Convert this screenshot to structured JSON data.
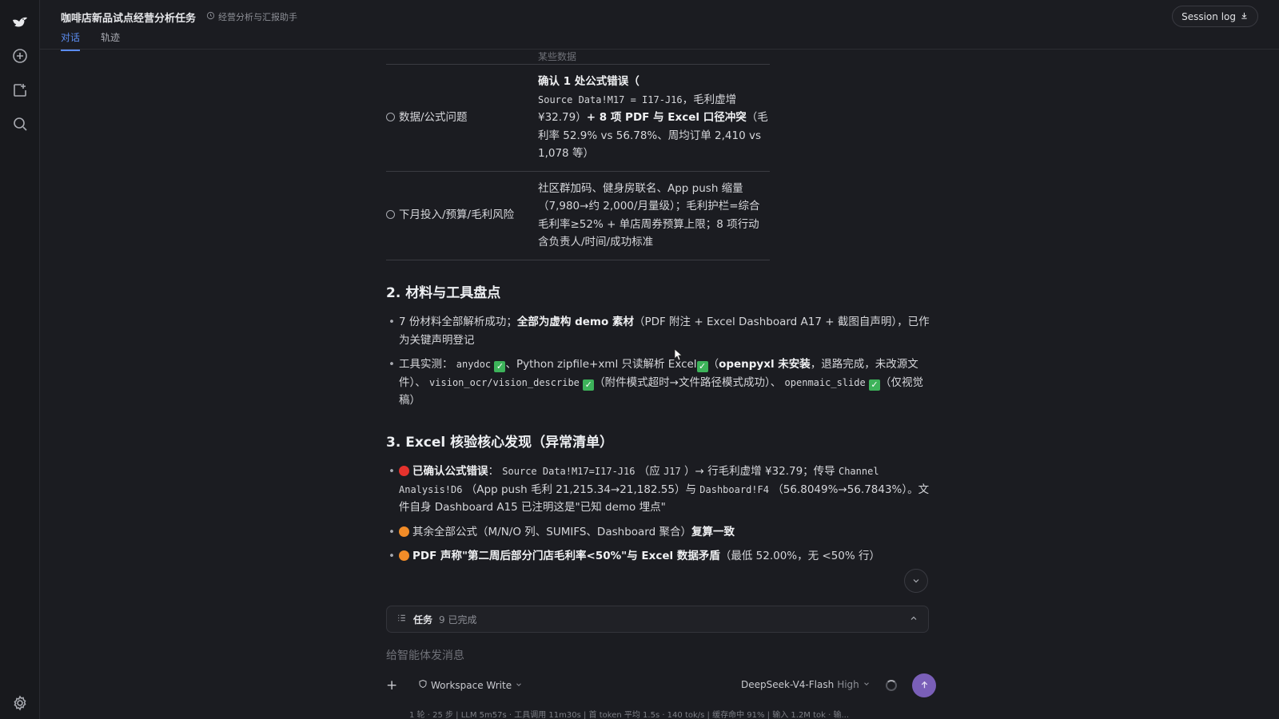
{
  "header": {
    "task_title": "咖啡店新品试点经营分析任务",
    "assistant_name": "经营分析与汇报助手",
    "tabs": [
      {
        "label": "对话",
        "active": true
      },
      {
        "label": "轨迹",
        "active": false
      }
    ],
    "session_log_label": "Session log"
  },
  "sidebar": {
    "icons": [
      "logo-icon",
      "new-chat-icon",
      "share-icon",
      "search-icon",
      "settings-icon"
    ]
  },
  "table": {
    "cut_row": "某些数据",
    "rows": [
      {
        "label": "数据/公式问题",
        "value_parts": {
          "p1": "确认 1 处公式错误（",
          "p2": "Source Data!M17 = I17-J16",
          "p3": "，毛利虚增 ¥32.79）",
          "p4": "+ 8 项 PDF 与 Excel 口径冲突",
          "p5": "（毛利率 52.9% vs 56.78%、周均订单 2,410 vs 1,078 等）"
        }
      },
      {
        "label": "下月投入/预算/毛利风险",
        "value": "社区群加码、健身房联名、App push 缩量（7,980→约 2,000/月量级）；毛利护栏=综合毛利率≥52% + 单店周券预算上限；8 项行动含负责人/时间/成功标准"
      }
    ]
  },
  "section2": {
    "title": "2. 材料与工具盘点",
    "b1": {
      "t1": "7 份材料全部解析成功；",
      "t2": "全部为虚构 demo 素材",
      "t3": "（PDF 附注 + Excel Dashboard A17 + 截图自声明），已作为关键声明登记"
    },
    "b2": {
      "t1": "工具实测：",
      "c1": "anydoc",
      "t2": "、Python zipfile+xml 只读解析 Excel",
      "t3": "（",
      "t4": "openpyxl 未安装",
      "t5": "，退路完成，未改源文件）、",
      "c2": "vision_ocr/vision_describe",
      "t6": "（附件模式超时→文件路径模式成功）、",
      "c3": "openmaic_slide",
      "t7": "（仅视觉稿）"
    }
  },
  "section3": {
    "title": "3. Excel 核验核心发现（异常清单）",
    "b1": {
      "t1": "已确认公式错误",
      "t2": "：",
      "c1": "Source Data!M17=I17-J16",
      "t3": "（应",
      "c2": "J17",
      "t4": "）→ 行毛利虚增 ¥32.79；传导",
      "c3": "Channel Analysis!D6",
      "t5": "（App push 毛利 21,215.34→21,182.55）与",
      "c4": "Dashboard!F4",
      "t6": "（56.8049%→56.7843%）。文件自身 Dashboard A15 已注明这是\"已知 demo 埋点\""
    },
    "b2": {
      "t1": "其余全部公式（M/N/O 列、SUMIFS、Dashboard 聚合）",
      "t2": "复算一致"
    },
    "b3": {
      "t1": "PDF 声称\"第二周后部分门店毛利率<50%\"与 Excel 数据矛盾",
      "t2": "（最低 52.00%，无 <50% 行）"
    }
  },
  "tasks_bar": {
    "label": "任务",
    "count": "9 已完成"
  },
  "composer": {
    "placeholder": "给智能体发消息",
    "workspace_label": "Workspace Write",
    "model": "DeepSeek-V4-Flash",
    "level": "High"
  },
  "status_line": "1 轮 · 25 步   |   LLM 5m57s · 工具调用 11m30s   |   首 token 平均 1.5s · 140 tok/s   |   缓存命中 91%   |   输入 1.2M tok · 输...",
  "colors": {
    "accent": "#5b8cf0",
    "send_button": "#7a5fb8",
    "error_dot": "#e5322d",
    "warning_dot": "#f28c28",
    "check": "#3db35a"
  }
}
